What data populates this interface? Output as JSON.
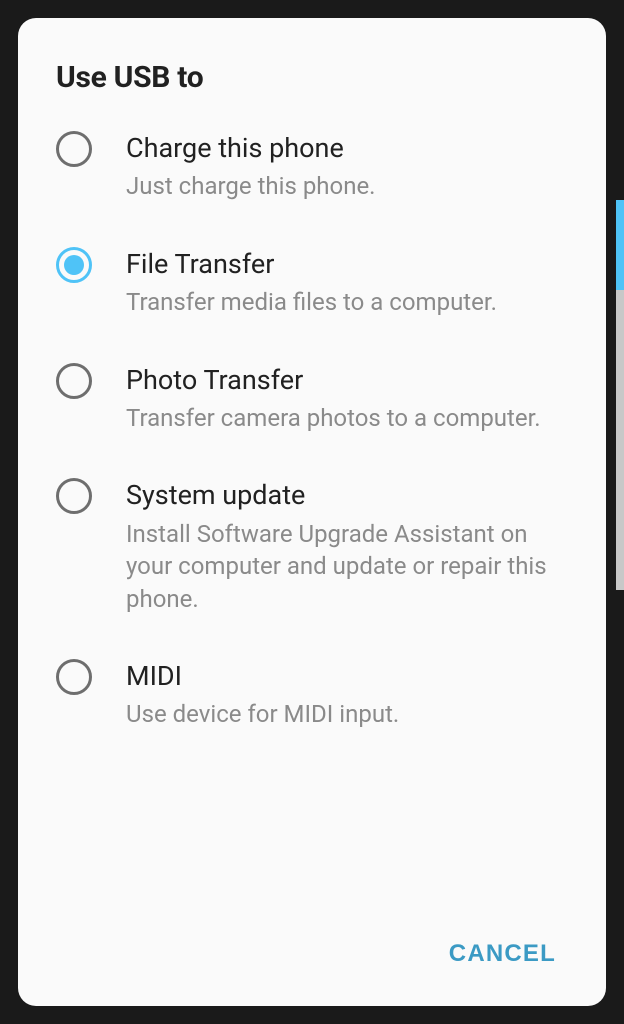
{
  "dialog": {
    "title": "Use USB to",
    "cancel_label": "CANCEL",
    "selected_index": 1,
    "options": [
      {
        "label": "Charge this phone",
        "description": "Just charge this phone."
      },
      {
        "label": "File Transfer",
        "description": "Transfer media files to a computer."
      },
      {
        "label": "Photo Transfer",
        "description": "Transfer camera photos to a computer."
      },
      {
        "label": "System update",
        "description": "Install Software Upgrade Assistant on your computer and update or repair this phone."
      },
      {
        "label": "MIDI",
        "description": "Use device for MIDI input."
      }
    ]
  }
}
